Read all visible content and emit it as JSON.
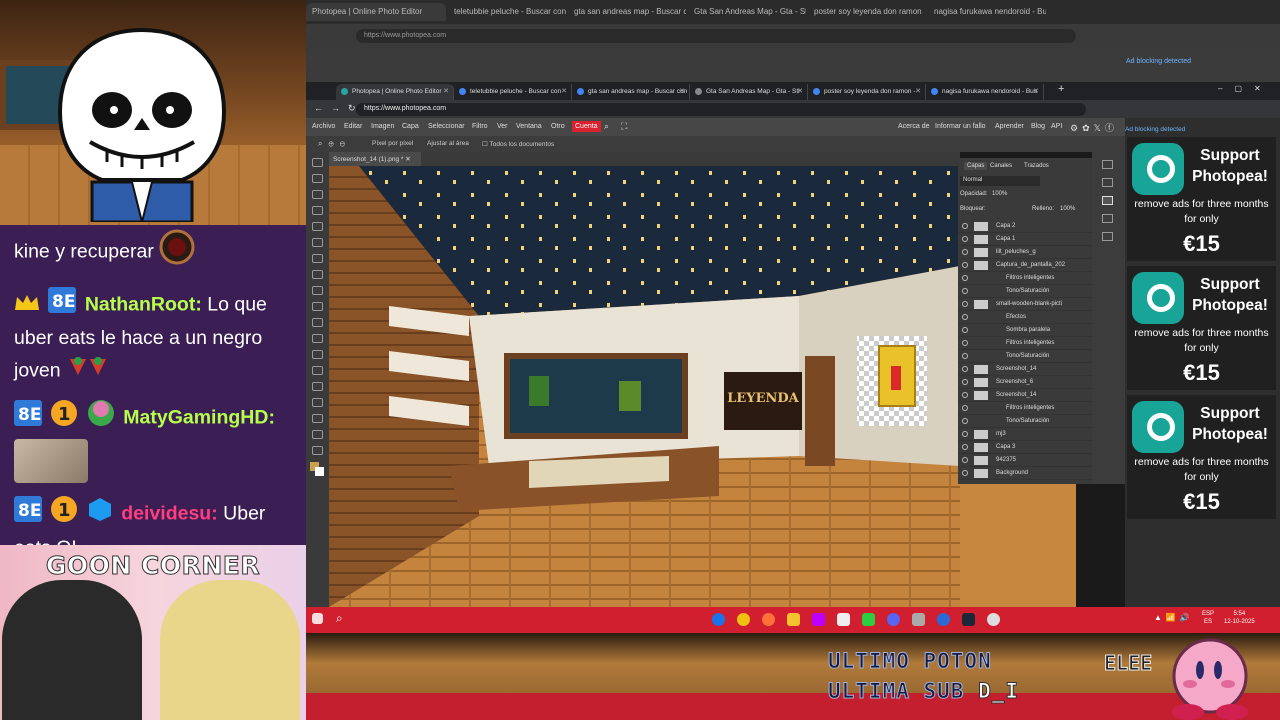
{
  "chat": {
    "messages": [
      {
        "user": "",
        "text": "kine y recuperar",
        "user_color": "#b5ff4a"
      },
      {
        "user": "NathanRoot:",
        "text": "Lo que uber eats le hace a un negro joven",
        "user_color": "#b5ff4a"
      },
      {
        "user": "MatyGamingHD:",
        "text": "",
        "user_color": "#b5ff4a"
      },
      {
        "user": "deividesu:",
        "text": "Uber eats QL",
        "user_color": "#ff3d7f"
      }
    ]
  },
  "goon_title": "GOON CORNER",
  "inner_browser": {
    "tabs": [
      "Photopea | Online Photo Editor",
      "teletubbie peluche - Buscar con",
      "gta san andreas map - Buscar con",
      "Gta San Andreas Map - Gta - Sti",
      "poster soy leyenda don ramon -",
      "nagisa furukawa nendoroid - Bus"
    ],
    "url": "https://www.photopea.com"
  },
  "outer_browser": {
    "tabs": [
      "Photopea | Online Photo Editor",
      "teletubbie peluche - Buscar con",
      "gta san andreas map - Buscar co",
      "Gta San Andreas Map - Gta - Sti",
      "poster soy leyenda don ramon",
      "nagisa furukawa nendoroid - Bu"
    ],
    "url": "https://www.photopea.com",
    "ad_notice": "Ad blocking detected"
  },
  "photopea": {
    "menu": [
      "Archivo",
      "Editar",
      "Imagen",
      "Capa",
      "Seleccionar",
      "Filtro",
      "Ver",
      "Ventana",
      "Otro"
    ],
    "account": "Cuenta",
    "right_links": [
      "Acerca de",
      "Informar un fallo",
      "Aprender",
      "Blog",
      "API"
    ],
    "options": [
      "Píxel por píxel",
      "Ajustar al área",
      "Todos los documentos"
    ],
    "doc_tab": "Screenshot_14 (1).png *",
    "panel_tabs": [
      "Capas",
      "Canales",
      "Trazados"
    ],
    "blend_mode": "Normal",
    "opacity_label": "Opacidad:",
    "opacity_value": "100%",
    "lock_label": "Bloquear:",
    "fill_label": "Relleno:",
    "fill_value": "100%",
    "layers": [
      "Capa 2",
      "Capa 1",
      "lilt_peluches_g",
      "Captura_de_pantalla_202",
      "Filtros inteligentes",
      "Tono/Saturación",
      "small-wooden-blank-picti",
      "Efectos",
      "Sombra paralela",
      "Filtros inteligentes",
      "Tono/Saturación",
      "Screenshot_14",
      "Screenshot_6",
      "Screenshot_14",
      "Filtros inteligentes",
      "Tono/Saturación",
      "mj3",
      "Capa 3",
      "942375",
      "Background"
    ],
    "poster_text": "LEYENDA"
  },
  "ad": {
    "heading": "Support Photopea!",
    "text": "remove ads for three months for only",
    "price": "€15",
    "notice": "Ad blocking detected"
  },
  "taskbar": {
    "lang": "ESP",
    "lang2": "ES",
    "time": "5:54",
    "date": "12-10-2025"
  },
  "overlay": {
    "line1": "ULTIMO POTON",
    "line2": "ULTIMA SUB",
    "line2b": "D_I",
    "corner": "ELEE"
  },
  "colors": {
    "chat_bg": "#3b1e54",
    "taskbar": "#d21f2f",
    "photopea_accent": "#18a497",
    "cuenta": "#d9212f"
  }
}
